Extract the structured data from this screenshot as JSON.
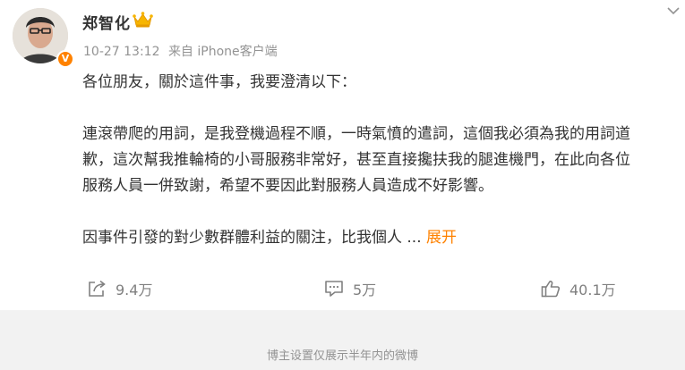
{
  "user": {
    "name": "郑智化"
  },
  "meta": {
    "timestamp": "10-27 13:12",
    "source": "来自 iPhone客户端"
  },
  "post": {
    "lines": [
      "各位朋友，關於這件事，我要澄清以下：",
      "",
      "連滾帶爬的用詞，是我登機過程不順，一時氣憤的遣詞，這個我必須為我的用詞道",
      "歉，這次幫我推輪椅的小哥服務非常好，甚至直接攙扶我的腿進機門，在此向各位",
      "服務人員一併致謝，希望不要因此對服務人員造成不好影響。",
      "",
      "因事件引發的對少數群體利益的關注，比我個人"
    ],
    "ellipsis": " ...",
    "expand_label": "展开"
  },
  "actions": {
    "share_count": "9.4万",
    "comment_count": "5万",
    "like_count": "40.1万"
  },
  "footer": {
    "notice": "博主设置仅展示半年内的微博"
  },
  "colors": {
    "accent": "#ff8200",
    "text": "#333333",
    "muted": "#939393",
    "footer_bg": "#f2f2f2"
  },
  "icons": {
    "verified": "verified-v-badge",
    "crown": "member-crown-icon",
    "more": "chevron-down-icon",
    "share": "share-icon",
    "comment": "comment-icon",
    "like": "thumbs-up-icon"
  }
}
